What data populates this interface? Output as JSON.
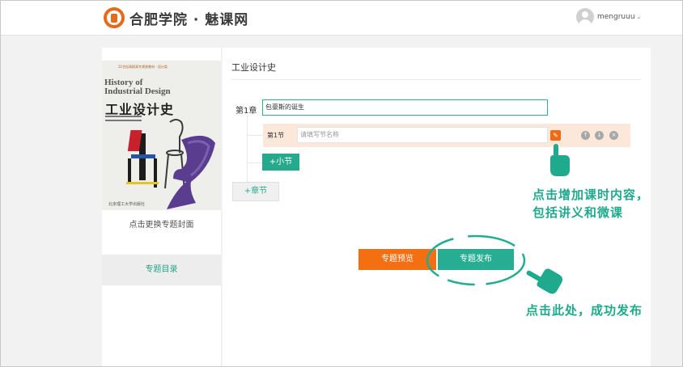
{
  "header": {
    "logo_text": "合肥学院 · 魅课网",
    "username": "mengruuu",
    "caret": "⌄"
  },
  "left": {
    "cover": {
      "series": "21世纪高职高专规划教材 · 设计类",
      "title_en_line1": "History of",
      "title_en_line2": "Industrial Design",
      "title_cn": "工业设计史",
      "publisher": "北京理工大学出版社"
    },
    "change_cover_label": "点击更换专题封面",
    "topic_directory_label": "专题目录"
  },
  "main": {
    "title": "工业设计史",
    "chapter_label": "第1章",
    "chapter_value": "包豪斯的诞生",
    "section_label": "第1节",
    "section_placeholder": "请填写节名称",
    "add_section_label": "+小节",
    "add_chapter_label": "+章节",
    "preview_label": "专题预览",
    "publish_label": "专题发布"
  },
  "annotations": {
    "add_content_line1": "点击增加课时内容，",
    "add_content_line2": "包括讲义和微课",
    "publish_hint": "点击此处，成功发布"
  },
  "icons": {
    "edit": "pencil-icon",
    "up": "arrow-up-icon",
    "down": "arrow-down-icon",
    "remove": "close-icon"
  },
  "colors": {
    "brand_orange": "#f36f12",
    "brand_green": "#26ad92",
    "section_bg": "#fbe8da"
  }
}
